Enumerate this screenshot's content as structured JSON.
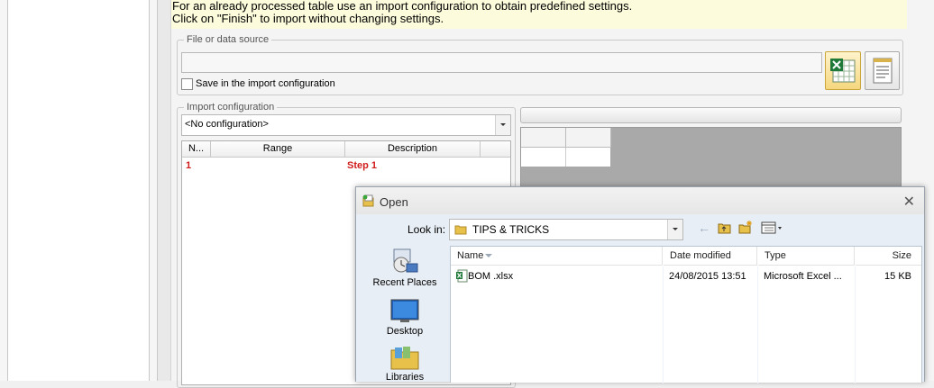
{
  "info": {
    "line1": "For an already processed table use an import configuration to obtain predefined settings.",
    "line2": "Click on \"Finish\" to import without changing settings."
  },
  "source_group": {
    "legend": "File or data source",
    "path_value": "",
    "save_checkbox_label": "Save in the import configuration",
    "save_checked": false
  },
  "import_group": {
    "legend": "Import configuration",
    "selected": "<No configuration>",
    "columns": [
      "N...",
      "Range",
      "Description"
    ],
    "rows": [
      {
        "n": "1",
        "range": "",
        "description": "Step 1"
      }
    ]
  },
  "open_dialog": {
    "title": "Open",
    "look_in_label": "Look in:",
    "look_in_value": "TIPS & TRICKS",
    "places": [
      "Recent Places",
      "Desktop",
      "Libraries"
    ],
    "columns": [
      "Name",
      "Date modified",
      "Type",
      "Size"
    ],
    "files": [
      {
        "name": "BOM .xlsx",
        "date": "24/08/2015 13:51",
        "type": "Microsoft Excel ...",
        "size": "15 KB"
      }
    ]
  },
  "colors": {
    "info_bg": "#fcfbdc",
    "step_red": "#d11c1c",
    "excel_green": "#1f7a3a",
    "folder_yellow": "#e8c14a"
  }
}
